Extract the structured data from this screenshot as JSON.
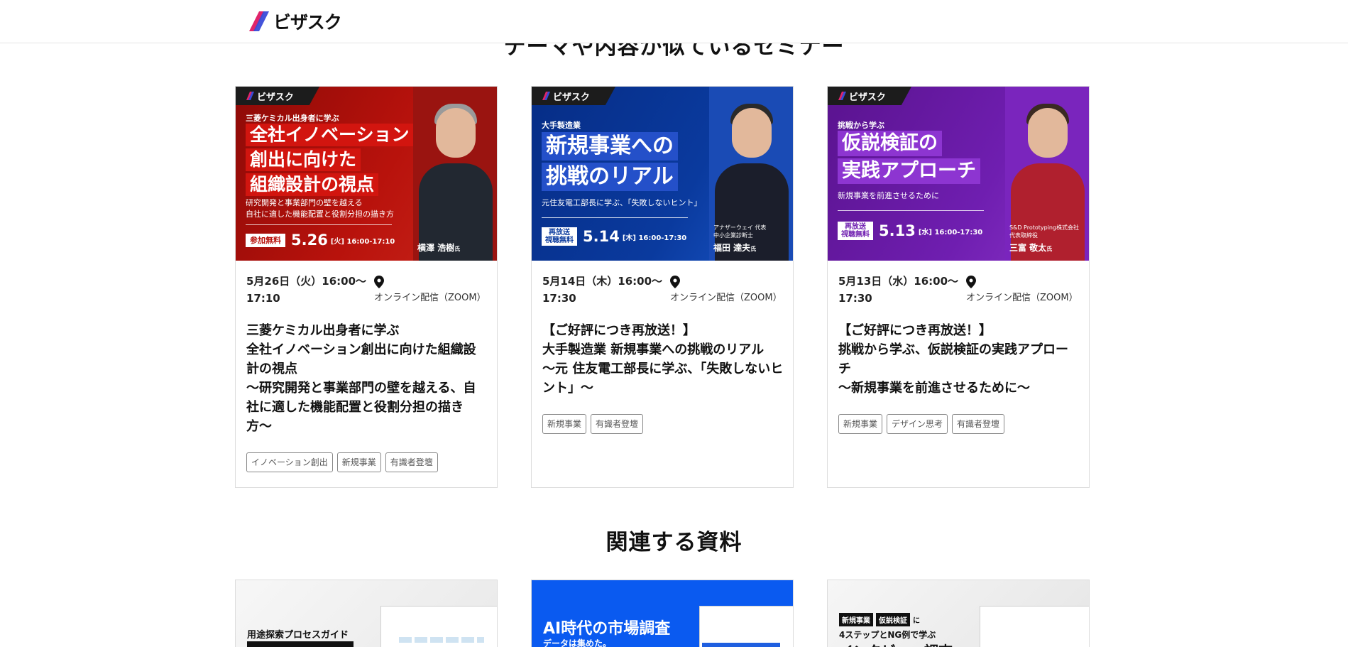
{
  "header": {
    "logo_text": "ビザスク"
  },
  "section_similar": {
    "title": "テーマや内容が似ているセミナー"
  },
  "section_docs": {
    "title": "関連する資料"
  },
  "colors": {
    "red": "#b8120c",
    "blue": "#0a3a9e",
    "purple": "#6f1eb0",
    "logo_blue": "#3a4bd8",
    "logo_pink": "#e0246a"
  },
  "seminars": [
    {
      "banner": {
        "badge": "ビザスク",
        "kicker": "三菱ケミカル出身者に学ぶ",
        "headline": [
          "全社イノベーション",
          "創出に向けた",
          "組織設計の視点"
        ],
        "sub": [
          "研究開発と事業部門の壁を越える",
          "自社に適した機能配置と役割分担の描き方"
        ],
        "pill": "参加無料",
        "date_big": "5.26",
        "date_small": "[火]  16:00-17:10",
        "speaker": "横澤 浩樹",
        "speaker_suffix": "氏"
      },
      "date": "5月26日（火）16:00〜17:10",
      "place": "オンライン配信（ZOOM）",
      "title_lines": [
        "三菱ケミカル出身者に学ぶ",
        "全社イノベーション創出に向けた組織設計の視点",
        "〜研究開発と事業部門の壁を越える、自社に適した機能配置と役割分担の描き方〜"
      ],
      "tags": [
        "イノベーション創出",
        "新規事業",
        "有識者登壇"
      ]
    },
    {
      "banner": {
        "badge": "ビザスク",
        "kicker": "大手製造業",
        "headline": [
          "新規事業への",
          "挑戦のリアル"
        ],
        "sub": [
          "元住友電工部長に学ぶ、「失敗しないヒント」"
        ],
        "pill": "再放送\n視聴無料",
        "date_big": "5.14",
        "date_small": "[木]  16:00-17:30",
        "speaker_title": "アナザーウェイ 代表\n中小企業診断士",
        "speaker": "福田 達夫",
        "speaker_suffix": "氏"
      },
      "date": "5月14日（木）16:00〜17:30",
      "place": "オンライン配信（ZOOM）",
      "title_lines": [
        "【ご好評につき再放送！】",
        "大手製造業 新規事業への挑戦のリアル",
        "〜元 住友電工部長に学ぶ、「失敗しないヒント」〜"
      ],
      "tags": [
        "新規事業",
        "有識者登壇"
      ]
    },
    {
      "banner": {
        "badge": "ビザスク",
        "kicker": "挑戦から学ぶ",
        "headline": [
          "仮説検証の",
          "実践アプローチ"
        ],
        "sub": [
          "新規事業を前進させるために"
        ],
        "pill": "再放送\n視聴無料",
        "date_big": "5.13",
        "date_small": "[水]  16:00-17:30",
        "speaker_title": "S&D Prototyping株式会社\n代表取締役",
        "speaker": "三富 敬太",
        "speaker_suffix": "氏"
      },
      "date": "5月13日（水）16:00〜17:30",
      "place": "オンライン配信（ZOOM）",
      "title_lines": [
        "【ご好評につき再放送！】",
        "挑戦から学ぶ、仮説検証の実践アプローチ",
        "〜新規事業を前進させるために〜"
      ],
      "tags": [
        "新規事業",
        "デザイン思考",
        "有識者登壇"
      ]
    }
  ],
  "docs": [
    {
      "line1": "用途探索プロセスガイド"
    },
    {
      "line1": "AI時代の市場調査",
      "line2": "データは集めた。"
    },
    {
      "tag1": "新規事業",
      "tag2": "仮説検証",
      "tag_suffix": "に",
      "line1": "4ステップとNG例で学ぶ",
      "line2": "インタビュー調査"
    }
  ]
}
